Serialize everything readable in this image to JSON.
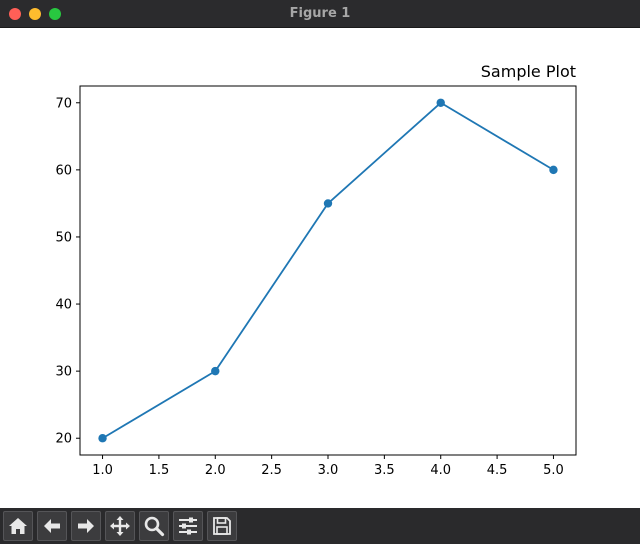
{
  "window": {
    "title": "Figure 1"
  },
  "chart_data": {
    "type": "line",
    "title": "Sample Plot",
    "xlabel": "",
    "ylabel": "",
    "x": [
      1.0,
      2.0,
      3.0,
      4.0,
      5.0
    ],
    "series": [
      {
        "values": [
          20,
          30,
          55,
          70,
          60
        ],
        "color": "#1f77b4",
        "marker": "circle"
      }
    ],
    "xlim": [
      0.8,
      5.2
    ],
    "ylim": [
      17.5,
      72.5
    ],
    "xticks": [
      "1.0",
      "1.5",
      "2.0",
      "2.5",
      "3.0",
      "3.5",
      "4.0",
      "4.5",
      "5.0"
    ],
    "yticks": [
      "20",
      "30",
      "40",
      "50",
      "60",
      "70"
    ],
    "grid": false,
    "title_loc": "right"
  },
  "toolbar": {
    "buttons": [
      {
        "icon": "home-icon"
      },
      {
        "icon": "back-arrow-icon"
      },
      {
        "icon": "forward-arrow-icon"
      },
      {
        "icon": "pan-icon"
      },
      {
        "icon": "zoom-icon"
      },
      {
        "icon": "configure-subplots-icon"
      },
      {
        "icon": "save-icon"
      }
    ]
  }
}
